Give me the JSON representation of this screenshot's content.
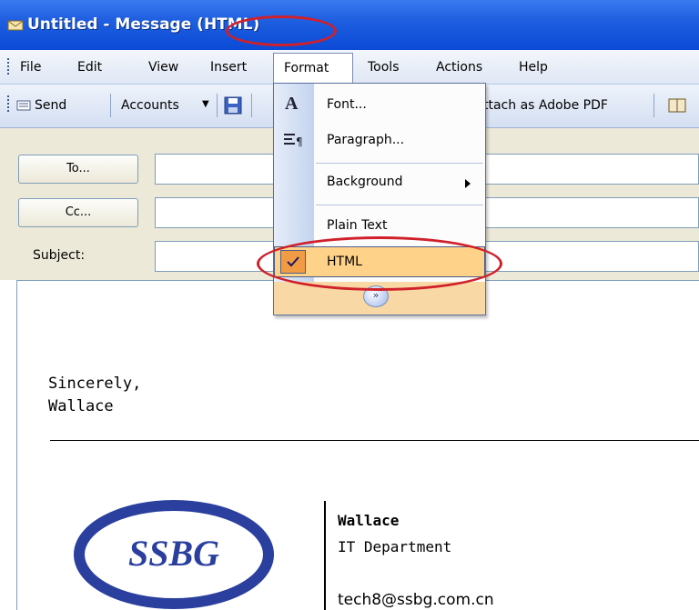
{
  "window": {
    "title": "Untitled - Message (HTML)"
  },
  "menubar": {
    "items": [
      {
        "label": "File"
      },
      {
        "label": "Edit"
      },
      {
        "label": "View"
      },
      {
        "label": "Insert"
      },
      {
        "label": "Format"
      },
      {
        "label": "Tools"
      },
      {
        "label": "Actions"
      },
      {
        "label": "Help"
      }
    ]
  },
  "toolbar": {
    "send_label": "Send",
    "accounts_label": "Accounts",
    "attach_pdf_label": "ttach as Adobe PDF"
  },
  "form": {
    "to_label": "To...",
    "cc_label": "Cc...",
    "subject_label": "Subject:"
  },
  "format_menu": {
    "items": [
      {
        "label": "Font...",
        "icon": "font-icon"
      },
      {
        "label": "Paragraph...",
        "icon": "paragraph-icon"
      },
      {
        "label": "Background",
        "has_submenu": true
      },
      {
        "label": "Plain Text"
      },
      {
        "label": "HTML",
        "checked": true
      }
    ],
    "expand_icon": "chevron-double-down-icon"
  },
  "message_body": {
    "closing": "Sincerely,",
    "signature_first": "Wallace",
    "sig_name": "Wallace",
    "sig_department": "IT Department",
    "sig_email": "tech8@ssbg.com.cn",
    "logo_text": "SSBG"
  },
  "colors": {
    "titlebar": "#0a4ad6",
    "annotation": "#d0202a",
    "menu_highlight": "#ffd28a",
    "logo_blue": "#2a3f9e"
  }
}
